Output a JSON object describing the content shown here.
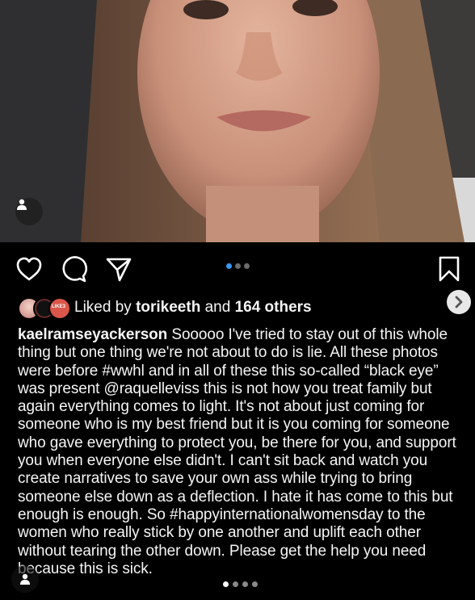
{
  "post": {
    "photo_description_icon": "person-tag-icon",
    "likes": {
      "prefix": "Liked by",
      "user": "torikeeth",
      "connector": "and",
      "others": "164 others"
    },
    "caption": {
      "username": "kaelramseyackerson",
      "text": "Sooooo I've tried to stay out of this whole thing but one thing we're not about to do is lie. All these photos were before #wwhl and in all of these this so-called “black eye” was present @raquelleviss this is not how you treat family but again everything comes to light. It's not about just coming for someone who is my best friend but it is you coming for someone who gave everything to protect you, be there for you, and support you when everyone else didn't. I can't sit back and watch you create narratives to save your own ass while trying to bring someone else down as a deflection. I hate it has come to this but enough is enough. So #happyinternationalwomensday to the women who really stick by one another and uplift each other without tearing the other down. Please get the help you need because this is sick."
    },
    "carousel": {
      "top_dots": 3,
      "top_active": 0,
      "bottom_dots": 4,
      "bottom_active": 0
    },
    "avatar_badge_text": "LIKE3"
  },
  "icons": {
    "like": "heart-icon",
    "comment": "comment-icon",
    "share": "share-icon",
    "save": "bookmark-icon",
    "next": "chevron-right-icon"
  },
  "colors": {
    "background": "#000000",
    "text": "#f5f5f5",
    "active_dot": "#3897f0"
  }
}
